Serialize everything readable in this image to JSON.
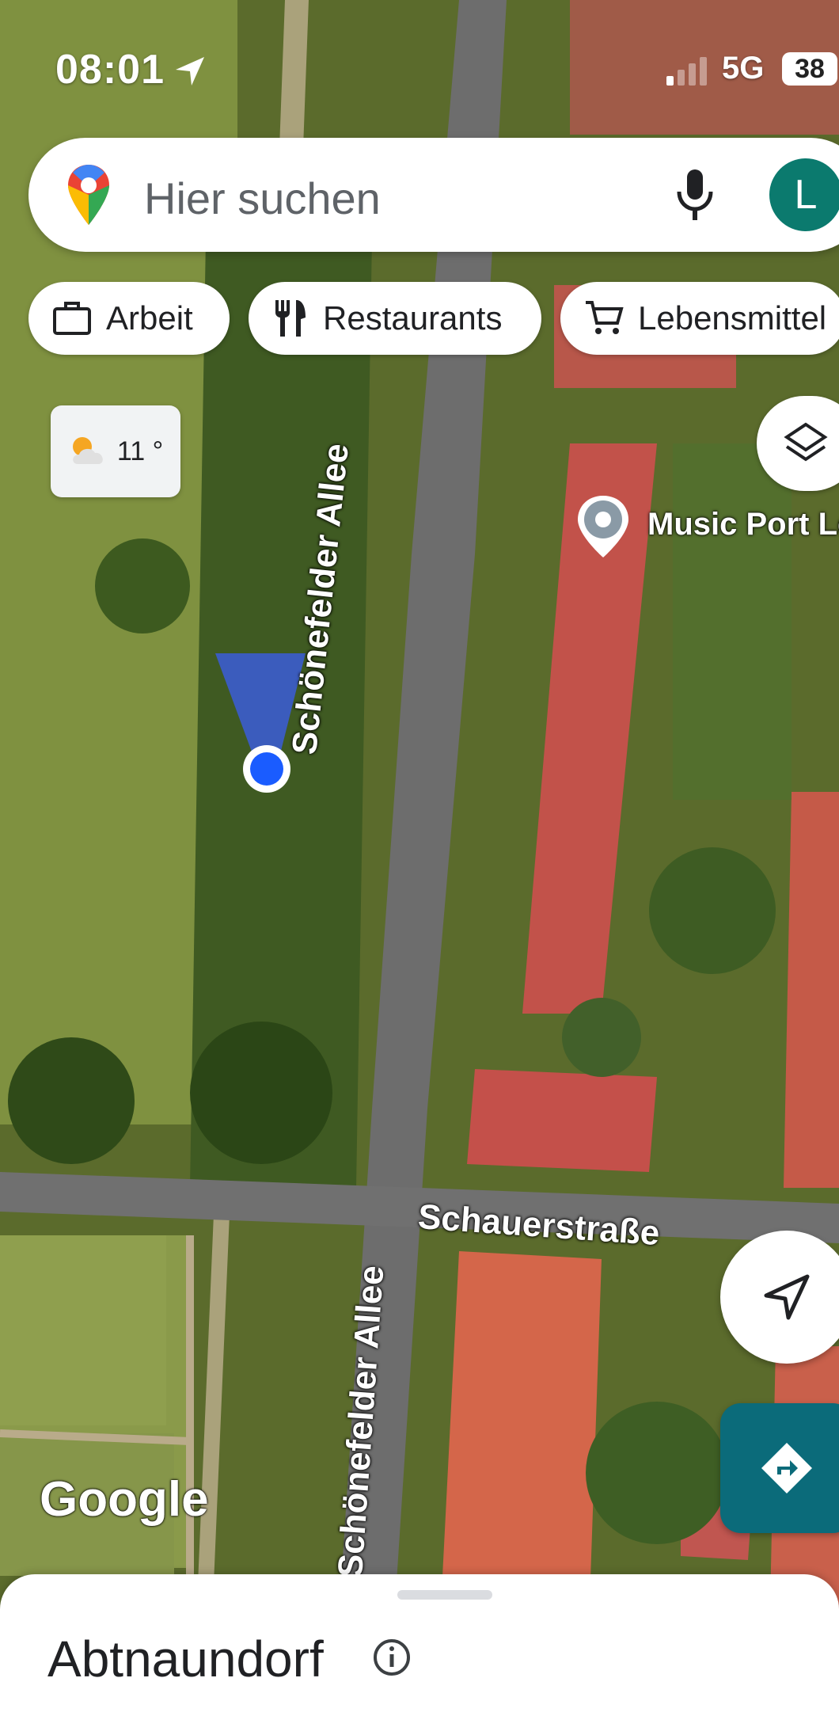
{
  "status_bar": {
    "time": "08:01",
    "network": "5G",
    "battery": "38"
  },
  "search": {
    "placeholder": "Hier suchen",
    "avatar_letter": "L"
  },
  "chips": [
    {
      "label": "Arbeit",
      "icon": "briefcase-icon"
    },
    {
      "label": "Restaurants",
      "icon": "fork-knife-icon"
    },
    {
      "label": "Lebensmittel",
      "icon": "cart-icon"
    }
  ],
  "weather": {
    "temp": "11 °",
    "icon": "partly-cloudy-icon"
  },
  "map": {
    "poi_label": "Music Port Le",
    "streets": [
      "Schönefelder Allee",
      "Schönefelder Allee",
      "Schauerstraße"
    ],
    "attribution": "Google"
  },
  "sheet": {
    "title": "Abtnaundorf"
  },
  "colors": {
    "accent": "#0b6b7a",
    "location_dot": "#1a5cff",
    "avatar": "#0b7a6e"
  }
}
